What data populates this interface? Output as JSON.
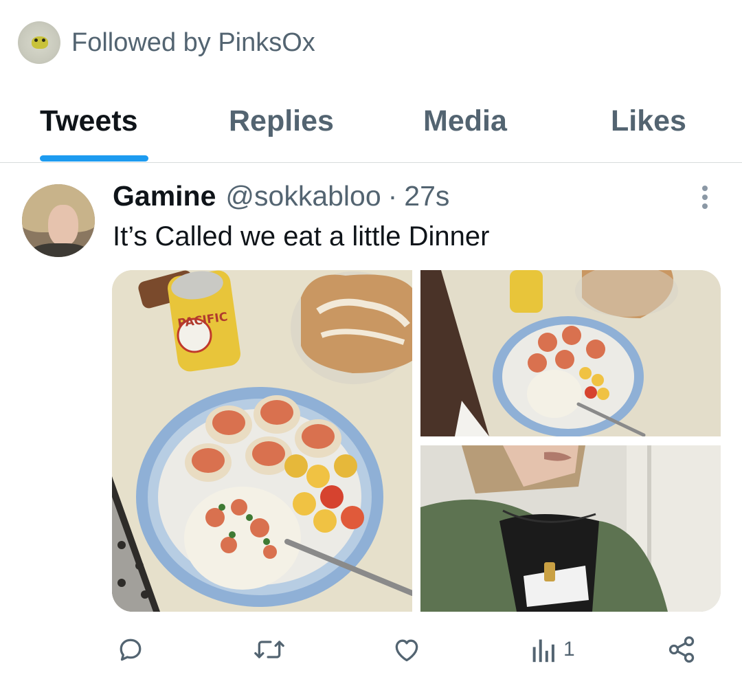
{
  "followed_by": {
    "text": "Followed by PinksOx"
  },
  "tabs": [
    {
      "label": "Tweets",
      "active": true
    },
    {
      "label": "Replies",
      "active": false
    },
    {
      "label": "Media",
      "active": false
    },
    {
      "label": "Likes",
      "active": false
    }
  ],
  "tweet": {
    "name": "Gamine",
    "handle": "@sokkabloo",
    "separator": "·",
    "time": "27s",
    "text": "It’s Called we eat a little Dinner",
    "can_label": "PACIFIC",
    "photos": [
      {
        "icon": "photo-dinner-plate"
      },
      {
        "icon": "photo-dinner-table"
      },
      {
        "icon": "photo-selfie"
      }
    ],
    "actions": {
      "reply_icon": "reply-icon",
      "retweet_icon": "retweet-icon",
      "like_icon": "like-icon",
      "views_icon": "views-icon",
      "views_count": "1",
      "share_icon": "share-icon"
    }
  },
  "colors": {
    "accent": "#1d9bf0",
    "secondary_text": "#536471",
    "primary_text": "#0f1419",
    "divider": "#d7dbdc"
  }
}
